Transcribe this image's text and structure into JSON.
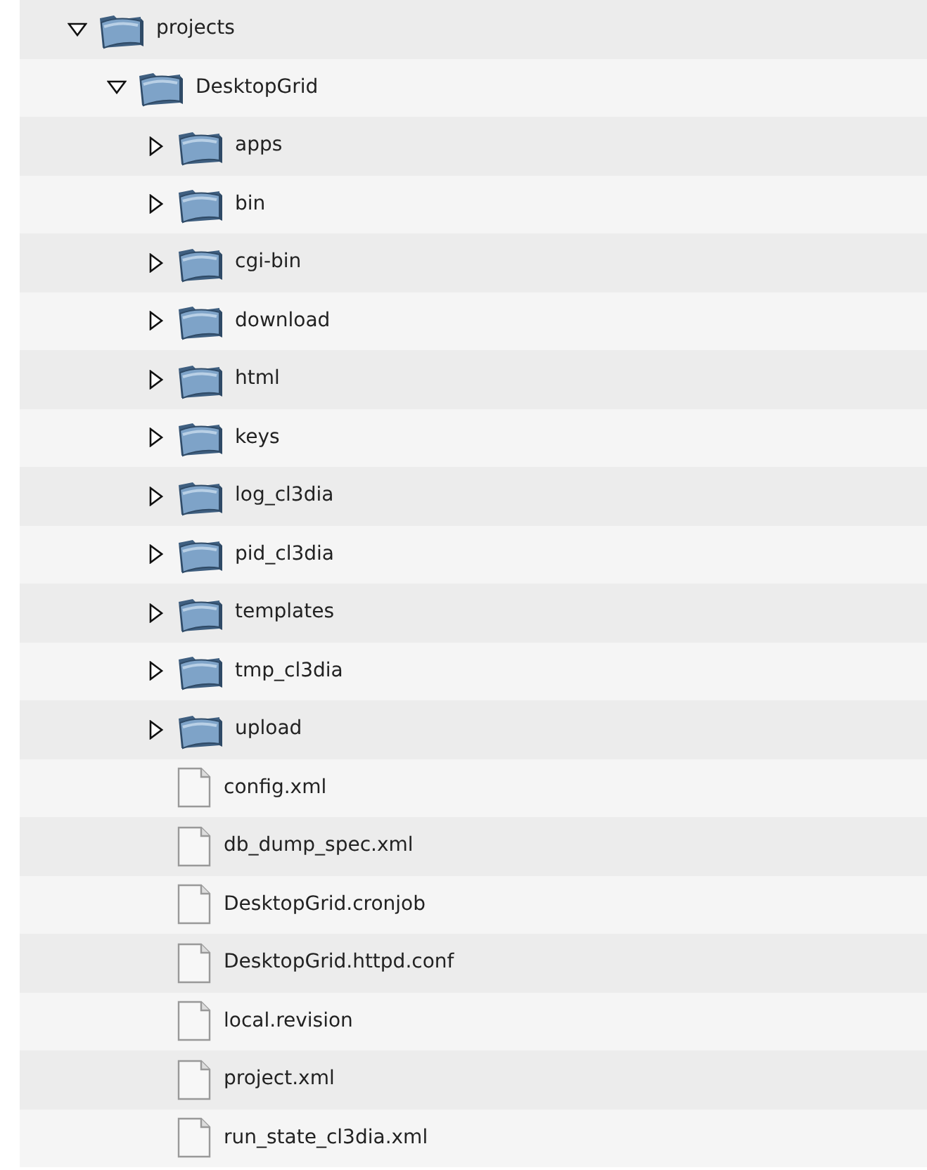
{
  "tree": [
    {
      "kind": "folder",
      "label": "projects",
      "expanded": true,
      "children": [
        {
          "kind": "folder",
          "label": "DesktopGrid",
          "expanded": true,
          "children": [
            {
              "kind": "folder",
              "label": "apps",
              "expanded": false
            },
            {
              "kind": "folder",
              "label": "bin",
              "expanded": false
            },
            {
              "kind": "folder",
              "label": "cgi-bin",
              "expanded": false
            },
            {
              "kind": "folder",
              "label": "download",
              "expanded": false
            },
            {
              "kind": "folder",
              "label": "html",
              "expanded": false
            },
            {
              "kind": "folder",
              "label": "keys",
              "expanded": false
            },
            {
              "kind": "folder",
              "label": "log_cl3dia",
              "expanded": false
            },
            {
              "kind": "folder",
              "label": "pid_cl3dia",
              "expanded": false
            },
            {
              "kind": "folder",
              "label": "templates",
              "expanded": false
            },
            {
              "kind": "folder",
              "label": "tmp_cl3dia",
              "expanded": false
            },
            {
              "kind": "folder",
              "label": "upload",
              "expanded": false
            },
            {
              "kind": "file",
              "label": "config.xml"
            },
            {
              "kind": "file",
              "label": "db_dump_spec.xml"
            },
            {
              "kind": "file",
              "label": "DesktopGrid.cronjob"
            },
            {
              "kind": "file",
              "label": "DesktopGrid.httpd.conf"
            },
            {
              "kind": "file",
              "label": "local.revision"
            },
            {
              "kind": "file",
              "label": "project.xml"
            },
            {
              "kind": "file",
              "label": "run_state_cl3dia.xml"
            }
          ]
        }
      ]
    }
  ]
}
